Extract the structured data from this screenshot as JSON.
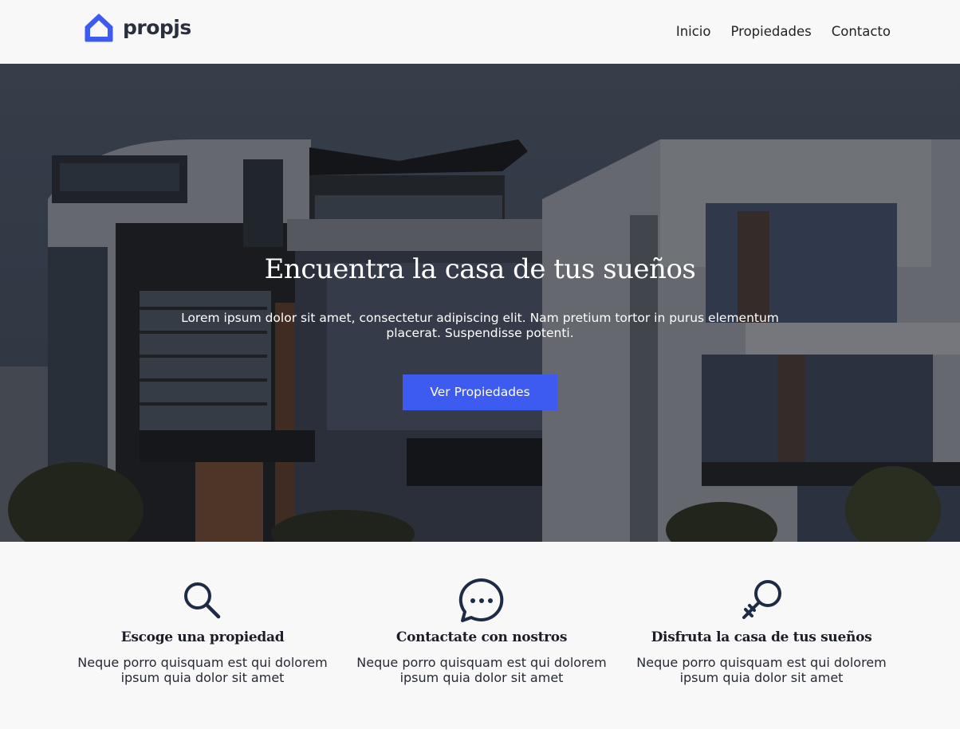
{
  "header": {
    "brand": "propjs",
    "nav": [
      "Inicio",
      "Propiedades",
      "Contacto"
    ]
  },
  "hero": {
    "title": "Encuentra la casa de tus sueños",
    "text": "Lorem ipsum dolor sit amet, consectetur adipiscing elit. Nam pretium tortor in purus elementum placerat. Suspendisse potenti.",
    "button_label": "Ver Propiedades"
  },
  "features": [
    {
      "icon": "search-icon",
      "title": "Escoge una propiedad",
      "text": "Neque porro quisquam est qui dolorem ipsum quia dolor sit amet"
    },
    {
      "icon": "chat-icon",
      "title": "Contactate con nostros",
      "text": "Neque porro quisquam est qui dolorem ipsum quia dolor sit amet"
    },
    {
      "icon": "key-icon",
      "title": "Disfruta la casa de tus sueños",
      "text": "Neque porro quisquam est qui dolorem ipsum quia dolor sit amet"
    }
  ],
  "colors": {
    "accent": "#3d5af1",
    "background": "#f8f8f9",
    "icon": "#1e2b45",
    "text": "#1f2433"
  }
}
